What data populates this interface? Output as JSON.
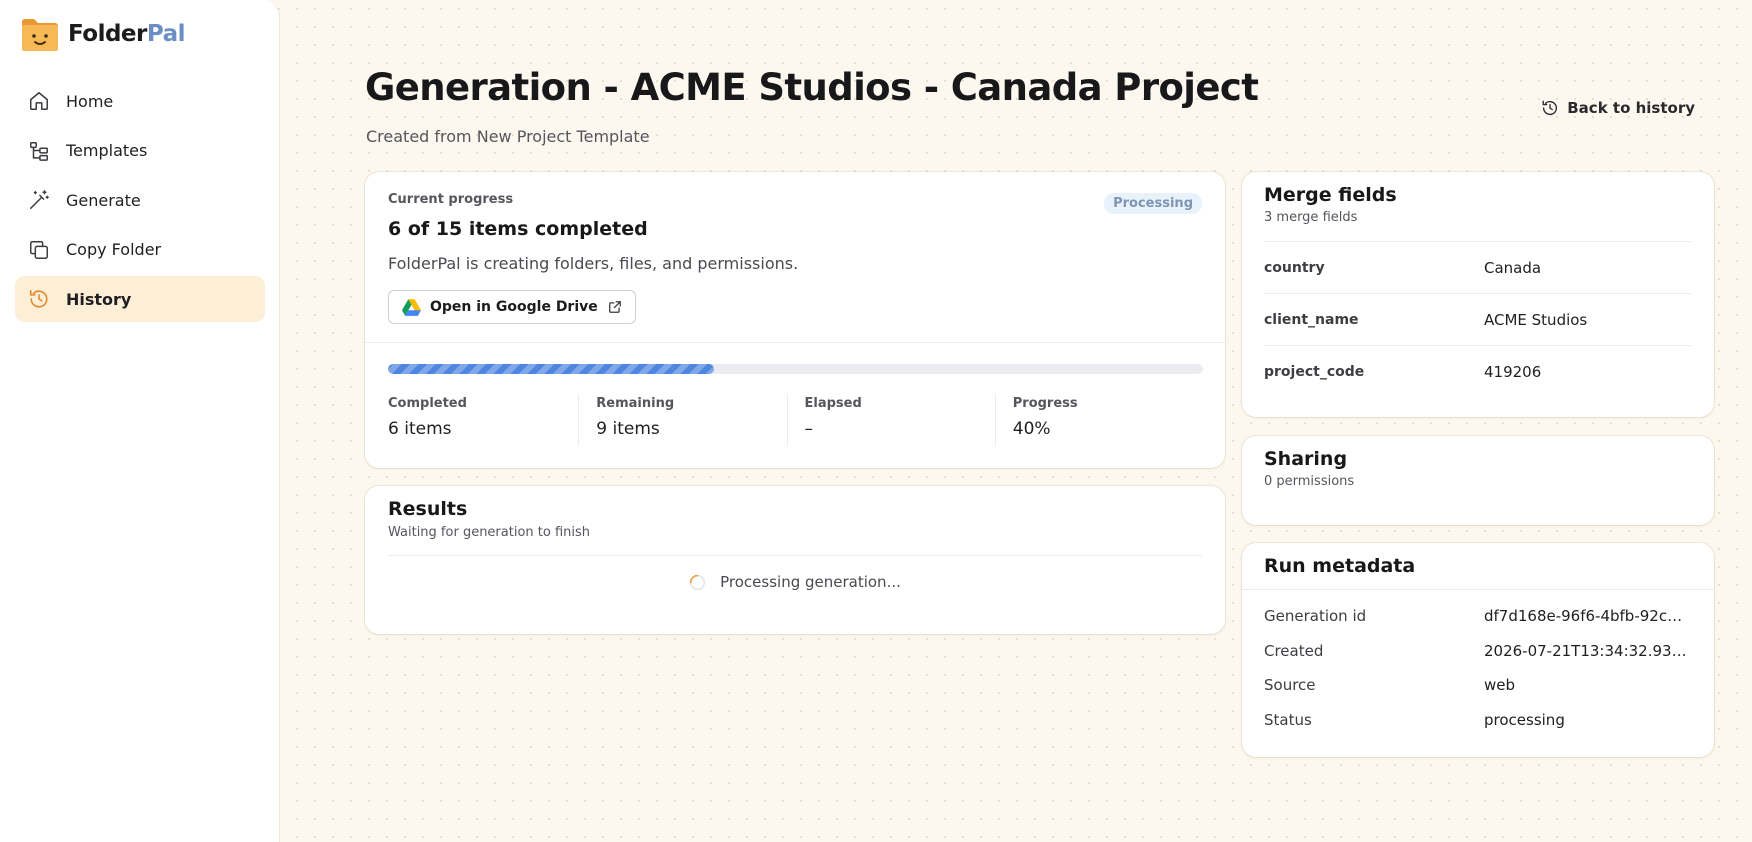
{
  "brand": {
    "name_part1": "Folder",
    "name_part2": "Pal",
    "colors": {
      "accent": "#6b8fc4",
      "logo": "#f5b04a"
    }
  },
  "sidebar": {
    "items": [
      {
        "label": "Home",
        "icon": "home-icon",
        "active": false
      },
      {
        "label": "Templates",
        "icon": "templates-icon",
        "active": false
      },
      {
        "label": "Generate",
        "icon": "magic-wand-icon",
        "active": false
      },
      {
        "label": "Copy Folder",
        "icon": "copy-icon",
        "active": false
      },
      {
        "label": "History",
        "icon": "history-icon",
        "active": true
      }
    ]
  },
  "header": {
    "title": "Generation - ACME Studios - Canada Project",
    "subtitle": "Created from New Project Template",
    "back_label": "Back to history"
  },
  "progress": {
    "label": "Current progress",
    "count_text": "6 of 15 items completed",
    "description": "FolderPal is creating folders, files, and permissions.",
    "status": "Processing",
    "drive_button": "Open in Google Drive",
    "percent": 40,
    "stats": [
      {
        "label": "Completed",
        "value": "6 items"
      },
      {
        "label": "Remaining",
        "value": "9 items"
      },
      {
        "label": "Elapsed",
        "value": "–"
      },
      {
        "label": "Progress",
        "value": "40%"
      }
    ]
  },
  "results": {
    "title": "Results",
    "subtitle": "Waiting for generation to finish",
    "processing_text": "Processing generation..."
  },
  "merge_fields": {
    "title": "Merge fields",
    "subtitle": "3 merge fields",
    "rows": [
      {
        "key": "country",
        "value": "Canada"
      },
      {
        "key": "client_name",
        "value": "ACME Studios"
      },
      {
        "key": "project_code",
        "value": "419206"
      }
    ]
  },
  "sharing": {
    "title": "Sharing",
    "subtitle": "0 permissions"
  },
  "metadata": {
    "title": "Run metadata",
    "rows": [
      {
        "key": "Generation id",
        "value": "df7d168e-96f6-4bfb-92c8…"
      },
      {
        "key": "Created",
        "value": "2026-07-21T13:34:32.9318…"
      },
      {
        "key": "Source",
        "value": "web"
      },
      {
        "key": "Status",
        "value": "processing"
      }
    ]
  }
}
